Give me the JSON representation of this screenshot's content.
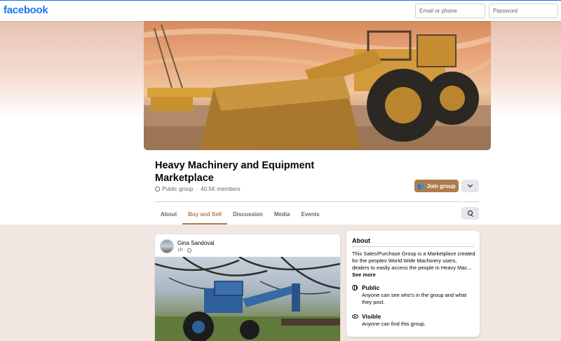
{
  "app": {
    "brand": "facebook",
    "brand_color": "#1877f2",
    "accent_color": "#b07b4e"
  },
  "login": {
    "email_placeholder": "Email or phone",
    "password_placeholder": "Password"
  },
  "group": {
    "name": "Heavy Machinery and Equipment Marketplace",
    "privacy": "Public group",
    "separator": "·",
    "members": "40.5K members",
    "join_label": "Join group",
    "cover_icon": "wheel-loader-photo"
  },
  "tabs": [
    {
      "label": "About",
      "active": false
    },
    {
      "label": "Buy and Sell",
      "active": true
    },
    {
      "label": "Discussion",
      "active": false
    },
    {
      "label": "Media",
      "active": false
    },
    {
      "label": "Events",
      "active": false
    }
  ],
  "post": {
    "author": "Gina Sandoval",
    "time": "1h",
    "separator": "·",
    "photo_icon": "blue-tractor-photo"
  },
  "about": {
    "title": "About",
    "description": "This Sales/Purchase Group is a Marketplace created for the peoples World Wide Machinery users, dealers to easily access the people in Heavy Mac...",
    "see_more": "See more",
    "items": [
      {
        "icon": "globe-icon",
        "title": "Public",
        "desc": "Anyone can see who's in the group and what they post."
      },
      {
        "icon": "eye-icon",
        "title": "Visible",
        "desc": "Anyone can find this group."
      }
    ]
  }
}
